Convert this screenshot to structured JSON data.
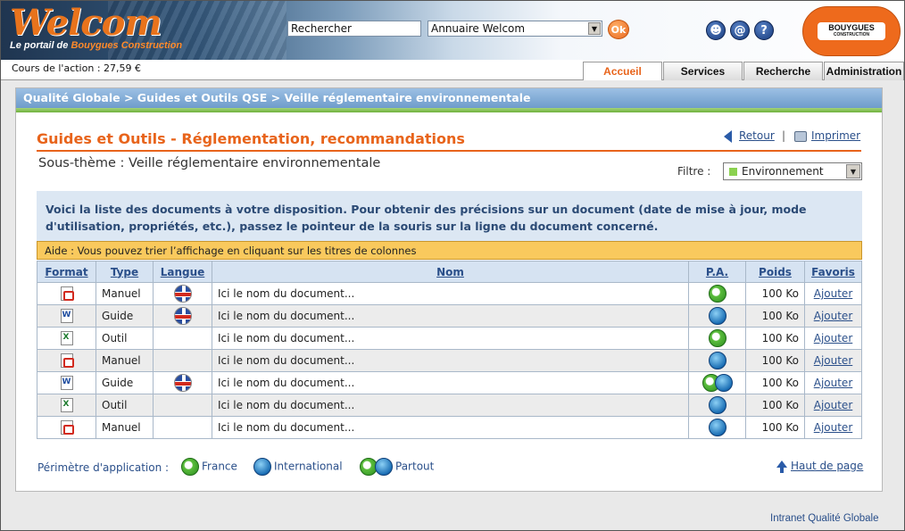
{
  "header": {
    "logo_word": "Welcom",
    "logo_sub_prefix": "Le portail de ",
    "logo_sub_brand": "Bouygues Construction",
    "search_value": "Rechercher",
    "directory_select": "Annuaire Welcom",
    "ok_label": "Ok",
    "brand_name": "BOUYGUES",
    "brand_sub": "CONSTRUCTION"
  },
  "stock": {
    "label": "Cours de l'action : 27,59  €"
  },
  "tabs": [
    {
      "label": "Accueil",
      "active": true
    },
    {
      "label": "Services"
    },
    {
      "label": "Recherche"
    },
    {
      "label": "Administration"
    }
  ],
  "breadcrumb": "Qualité Globale > Guides et Outils QSE > Veille réglementaire environnementale",
  "page": {
    "title": "Guides et Outils - Réglementation, recommandations",
    "subtitle": "Sous-thème : Veille réglementaire environnementale",
    "retour": "Retour",
    "separator": "|",
    "imprimer": "Imprimer",
    "filter_label": "Filtre :",
    "filter_value": "Environnement",
    "filter_color": "#8ad14f",
    "info": "Voici la liste des documents à votre disposition. Pour obtenir des précisions sur un document (date de mise à jour, mode d'utilisation, propriétés, etc.), passez le pointeur de la souris sur la ligne du document concerné.",
    "help": "Aide : Vous pouvez trier l’affichage en cliquant sur les titres de colonnes"
  },
  "table": {
    "headers": {
      "format": "Format",
      "type": "Type",
      "langue": "Langue",
      "nom": "Nom",
      "pa": "P.A.",
      "poids": "Poids",
      "favoris": "Favoris"
    },
    "rows": [
      {
        "format": "pdf-icon",
        "type": "Manuel",
        "langue": "uk-flag-icon",
        "nom": "Ici le nom du document...",
        "pa": "france",
        "poids": "100 Ko",
        "favoris": "Ajouter"
      },
      {
        "format": "word-icon",
        "type": "Guide",
        "langue": "uk-flag-icon",
        "nom": "Ici le nom du document...",
        "pa": "international",
        "poids": "100 Ko",
        "favoris": "Ajouter"
      },
      {
        "format": "excel-icon",
        "type": "Outil",
        "langue": "",
        "nom": "Ici le nom du document...",
        "pa": "france",
        "poids": "100 Ko",
        "favoris": "Ajouter"
      },
      {
        "format": "pdf-icon",
        "type": "Manuel",
        "langue": "",
        "nom": "Ici le nom du document...",
        "pa": "international",
        "poids": "100 Ko",
        "favoris": "Ajouter"
      },
      {
        "format": "word-icon",
        "type": "Guide",
        "langue": "uk-flag-icon",
        "nom": "Ici le nom du document...",
        "pa": "partout",
        "poids": "100 Ko",
        "favoris": "Ajouter"
      },
      {
        "format": "excel-icon",
        "type": "Outil",
        "langue": "",
        "nom": "Ici le nom du document...",
        "pa": "international",
        "poids": "100 Ko",
        "favoris": "Ajouter"
      },
      {
        "format": "pdf-icon",
        "type": "Manuel",
        "langue": "",
        "nom": "Ici le nom du document...",
        "pa": "international",
        "poids": "100 Ko",
        "favoris": "Ajouter"
      }
    ]
  },
  "legend": {
    "label": "Périmètre d'application :",
    "france": "France",
    "international": "International",
    "partout": "Partout"
  },
  "haut_de_page": "Haut de page",
  "footer": "Intranet Qualité Globale"
}
